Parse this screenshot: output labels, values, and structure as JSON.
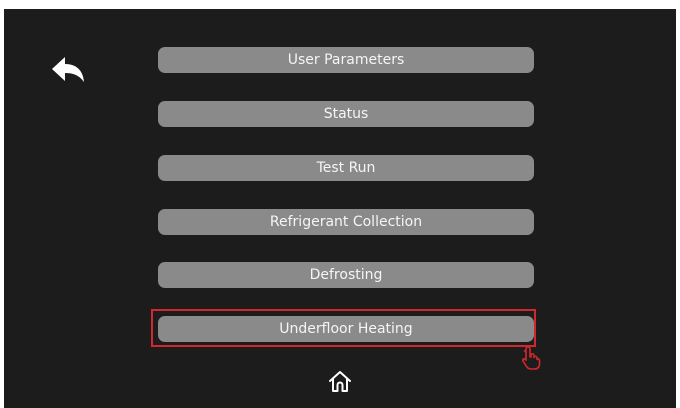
{
  "menu": {
    "items": [
      {
        "id": "user-parameters",
        "label": "User Parameters"
      },
      {
        "id": "status",
        "label": "Status"
      },
      {
        "id": "test-run",
        "label": "Test Run"
      },
      {
        "id": "refrigerant-collection",
        "label": "Refrigerant Collection"
      },
      {
        "id": "defrosting",
        "label": "Defrosting"
      },
      {
        "id": "underfloor-heating",
        "label": "Underfloor Heating"
      }
    ],
    "selected": "underfloor-heating"
  },
  "icons": {
    "back": "back-arrow-icon",
    "home": "home-icon",
    "pointer": "hand-pointer-icon"
  },
  "colors": {
    "background": "#1c1c1c",
    "button": "#8a8a8a",
    "button_text": "#f5f5f5",
    "highlight": "#d0282e"
  }
}
